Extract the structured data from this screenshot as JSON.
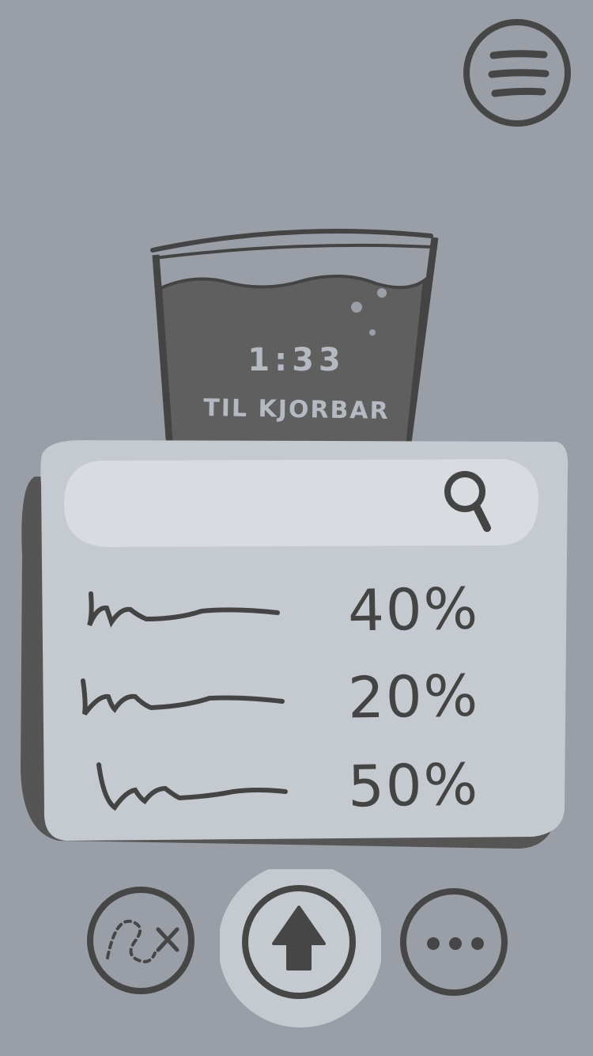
{
  "menu": {
    "icon": "hamburger-menu-icon"
  },
  "timer": {
    "time": "1:33",
    "caption": "TIL KJORBAR"
  },
  "search": {
    "value": "",
    "icon": "search-icon"
  },
  "list": {
    "items": [
      {
        "label_icon": "scribble-placeholder",
        "percent": "40%"
      },
      {
        "label_icon": "scribble-placeholder",
        "percent": "20%"
      },
      {
        "label_icon": "scribble-placeholder",
        "percent": "50%"
      }
    ]
  },
  "bottom_bar": {
    "left_icon": "route-add-icon",
    "center_icon": "up-arrow-icon",
    "right_icon": "more-dots-icon"
  },
  "colors": {
    "background": "#9a9fa7",
    "panel": "#c5c9d0",
    "panel_shadow": "#555555",
    "search": "#d8dbe0",
    "ink": "#444444",
    "liquid": "#5f5f5f"
  }
}
